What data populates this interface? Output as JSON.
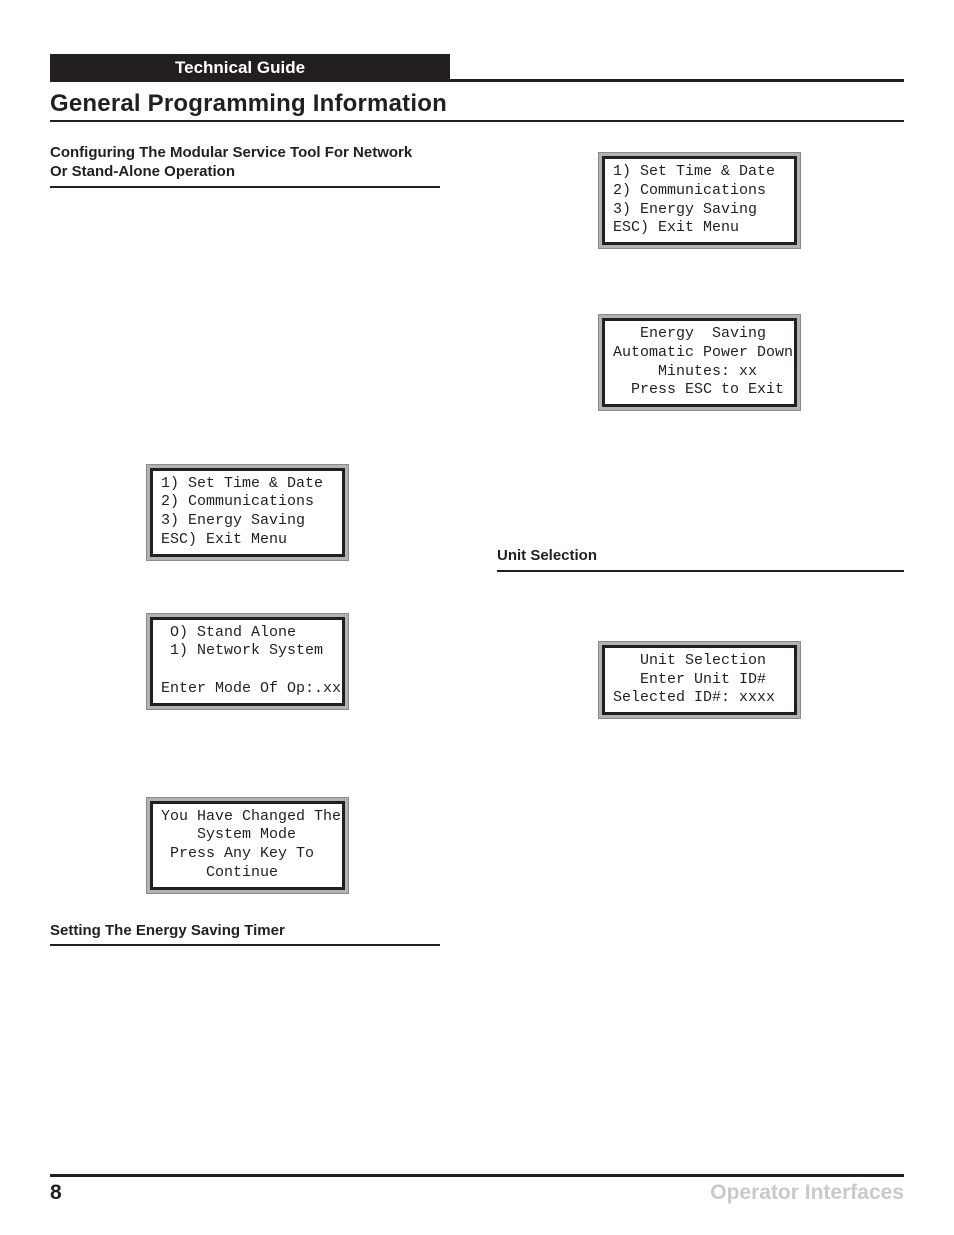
{
  "header": {
    "guide_title": "Technical Guide"
  },
  "title": "General Programming Information",
  "left": {
    "heading1": "Configuring The Modular Service Tool For Network Or Stand-Alone Operation",
    "lcd_menu": "1) Set Time & Date\n2) Communications\n3) Energy Saving\nESC) Exit Menu",
    "lcd_mode": " O) Stand Alone\n 1) Network System\n\nEnter Mode Of Op:.xx",
    "lcd_changed": "You Have Changed The\n    System Mode\n Press Any Key To\n     Continue",
    "heading2": "Setting The Energy Saving Timer"
  },
  "right": {
    "lcd_menu": "1) Set Time & Date\n2) Communications\n3) Energy Saving\nESC) Exit Menu",
    "lcd_energy": "   Energy  Saving\nAutomatic Power Down\n     Minutes: xx\n  Press ESC to Exit",
    "heading1": "Unit Selection",
    "lcd_unit": "   Unit Selection\n   Enter Unit ID#\nSelected ID#: xxxx\n"
  },
  "footer": {
    "page": "8",
    "label": "Operator Interfaces"
  }
}
